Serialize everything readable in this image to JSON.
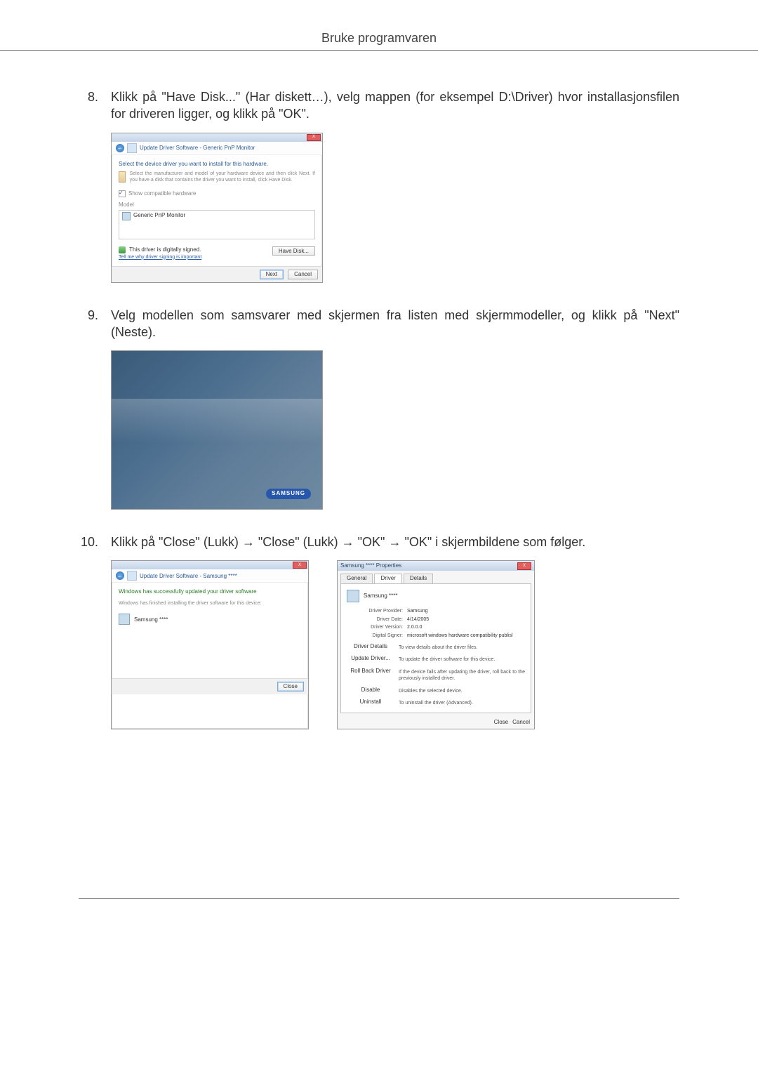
{
  "header": {
    "title": "Bruke programvaren"
  },
  "steps": {
    "s8": {
      "num": "8.",
      "text": "Klikk på \"Have Disk...\" (Har diskett…), velg mappen (for eksempel D:\\Driver) hvor installasjonsfilen for driveren ligger, og klikk på \"OK\"."
    },
    "s9": {
      "num": "9.",
      "text": "Velg modellen som samsvarer med skjermen fra listen med skjermmodeller, og klikk på \"Next\" (Neste)."
    },
    "s10": {
      "num": "10.",
      "text": "Klikk på \"Close\" (Lukk) → \"Close\" (Lukk) → \"OK\" → \"OK\" i skjermbildene som følger."
    }
  },
  "dlg1": {
    "crumb": "Update Driver Software - Generic PnP Monitor",
    "heading": "Select the device driver you want to install for this hardware.",
    "help": "Select the manufacturer and model of your hardware device and then click Next. If you have a disk that contains the driver you want to install, click Have Disk.",
    "chk": "Show compatible hardware",
    "model_label": "Model",
    "model_item": "Generic PnP Monitor",
    "signed": "This driver is digitally signed.",
    "why_link": "Tell me why driver signing is important",
    "havedisk": "Have Disk...",
    "next": "Next",
    "cancel": "Cancel",
    "close_x": "X"
  },
  "splash": {
    "logo": "SAMSUNG"
  },
  "dlg3": {
    "crumb": "Update Driver Software - Samsung ****",
    "heading": "Windows has successfully updated your driver software",
    "sub": "Windows has finished installing the driver software for this device:",
    "device": "Samsung ****",
    "close": "Close",
    "close_x": "X"
  },
  "prop": {
    "title": "Samsung **** Properties",
    "tabs": {
      "general": "General",
      "driver": "Driver",
      "details": "Details"
    },
    "device": "Samsung ****",
    "kv": {
      "provider_k": "Driver Provider:",
      "provider_v": "Samsung",
      "date_k": "Driver Date:",
      "date_v": "4/14/2005",
      "version_k": "Driver Version:",
      "version_v": "2.0.0.0",
      "signer_k": "Digital Signer:",
      "signer_v": "microsoft windows hardware compatibility publisl"
    },
    "btns": {
      "details": "Driver Details",
      "details_d": "To view details about the driver files.",
      "update": "Update Driver...",
      "update_d": "To update the driver software for this device.",
      "rollback": "Roll Back Driver",
      "rollback_d": "If the device fails after updating the driver, roll back to the previously installed driver.",
      "disable": "Disable",
      "disable_d": "Disables the selected device.",
      "uninstall": "Uninstall",
      "uninstall_d": "To uninstall the driver (Advanced)."
    },
    "close": "Close",
    "cancel": "Cancel",
    "close_x": "X"
  }
}
